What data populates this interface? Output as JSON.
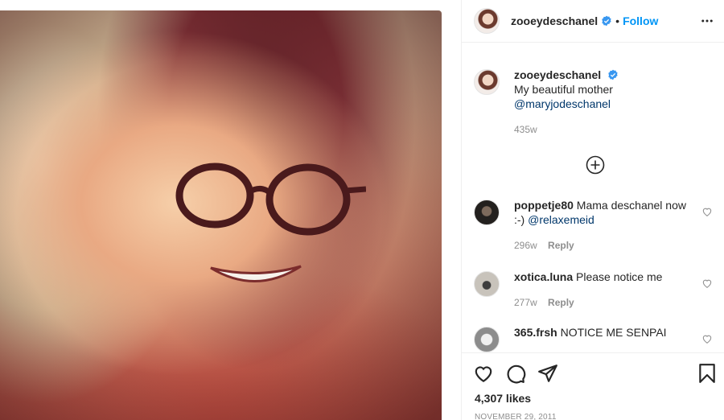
{
  "post": {
    "username": "zooeydeschanel",
    "follow_label": "Follow",
    "separator": "•",
    "caption_line1": "My beautiful mother",
    "caption_mention": "@maryjodeschanel",
    "caption_age": "435w"
  },
  "comments": [
    {
      "username": "poppetje80",
      "text": "Mama deschanel now :-) ",
      "mention": "@relaxemeid",
      "age": "296w",
      "reply_label": "Reply"
    },
    {
      "username": "xotica.luna",
      "text": "Please notice me",
      "age": "277w",
      "reply_label": "Reply"
    },
    {
      "username": "365.frsh",
      "text": "NOTICE ME SENPAI"
    }
  ],
  "footer": {
    "likes": "4,307 likes",
    "date": "NOVEMBER 29, 2011"
  },
  "icons": {
    "verified": "verified-badge-icon",
    "more": "more-options-icon",
    "load_more": "add-circle-icon",
    "like": "heart-icon",
    "comment": "comment-icon",
    "share": "share-icon",
    "save": "bookmark-icon"
  },
  "colors": {
    "accent": "#0095f6",
    "mention": "#00376b",
    "muted": "#8e8e8e"
  }
}
